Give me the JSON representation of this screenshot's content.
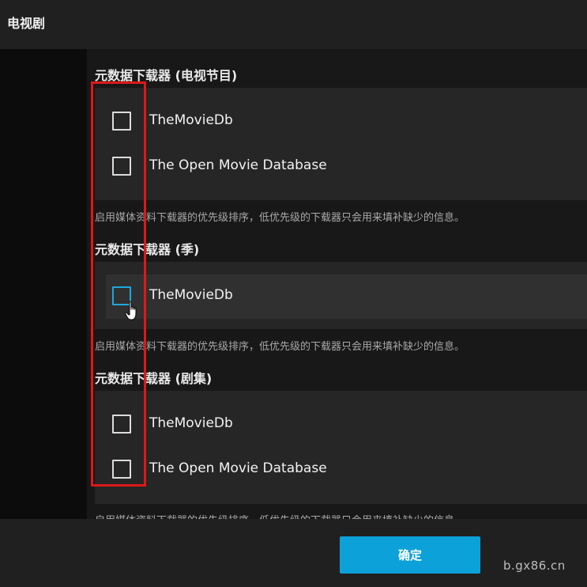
{
  "header": {
    "title": "电视剧"
  },
  "sections": [
    {
      "title": "元数据下载器 (电视节目)",
      "items": [
        {
          "label": "TheMovieDb"
        },
        {
          "label": "The Open Movie Database"
        }
      ],
      "hint": "启用媒体资料下载器的优先级排序，低优先级的下载器只会用来填补缺少的信息。"
    },
    {
      "title": "元数据下载器 (季)",
      "items": [
        {
          "label": "TheMovieDb"
        }
      ],
      "hint": "启用媒体资料下载器的优先级排序，低优先级的下载器只会用来填补缺少的信息。"
    },
    {
      "title": "元数据下载器 (剧集)",
      "items": [
        {
          "label": "TheMovieDb"
        },
        {
          "label": "The Open Movie Database"
        }
      ],
      "hint": "启用媒体资料下载器的优先级排序，低优先级的下载器只会用来填补缺少的信息。"
    }
  ],
  "footer": {
    "confirm_label": "确定"
  },
  "watermark": "b.gx86.cn",
  "colors": {
    "accent": "#0ca1d8",
    "focus_border": "#1fa6e0",
    "annotation_red": "#e01818"
  }
}
